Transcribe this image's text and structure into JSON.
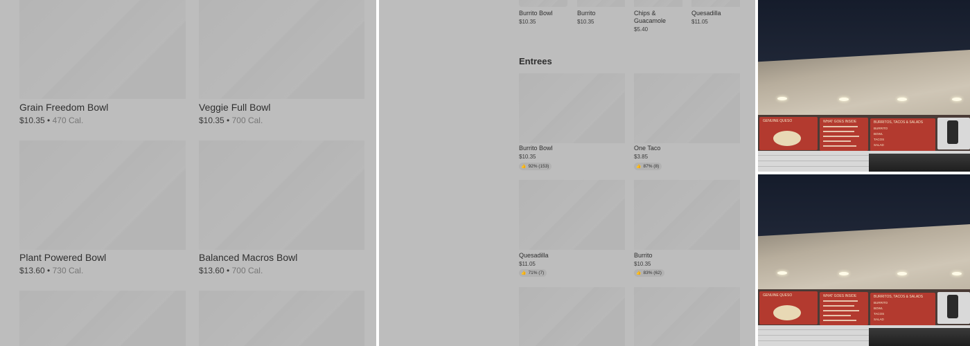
{
  "left_panel": {
    "items": [
      {
        "name": "Grain Freedom Bowl",
        "price": "$10.35",
        "calories": "470 Cal."
      },
      {
        "name": "Veggie Full Bowl",
        "price": "$10.35",
        "calories": "700 Cal."
      },
      {
        "name": "Plant Powered Bowl",
        "price": "$13.60",
        "calories": "730 Cal."
      },
      {
        "name": "Balanced Macros Bowl",
        "price": "$13.60",
        "calories": "700 Cal."
      }
    ],
    "separator": "•"
  },
  "middle_panel": {
    "top_row": [
      {
        "name": "Burrito Bowl",
        "price": "$10.35"
      },
      {
        "name": "Burrito",
        "price": "$10.35"
      },
      {
        "name": "Chips & Guacamole",
        "price": "$5.40"
      },
      {
        "name": "Quesadilla",
        "price": "$11.05"
      }
    ],
    "section_title": "Entrees",
    "entrees": [
      {
        "name": "Burrito Bowl",
        "price": "$10.35",
        "rating": "92% (153)"
      },
      {
        "name": "One Taco",
        "price": "$3.85",
        "rating": "87% (8)"
      },
      {
        "name": "Quesadilla",
        "price": "$11.05",
        "rating": "71% (7)"
      },
      {
        "name": "Burrito",
        "price": "$10.35",
        "rating": "83% (62)"
      }
    ],
    "thumbs_up_icon": "👍"
  },
  "right_panel": {
    "photo_board": {
      "board1_title": "GENUINE QUESO",
      "board2_title": "WHAT GOES INSIDE",
      "board3_title": "BURRITOS, TACOS & SALADS",
      "board3_items": [
        "BURRITO",
        "BOWL",
        "TACOS",
        "SALAD"
      ]
    }
  },
  "colors": {
    "overlay_gray": "#bdbdbd",
    "placeholder": "#b5b5b5",
    "menu_red": "#b33a2f"
  }
}
